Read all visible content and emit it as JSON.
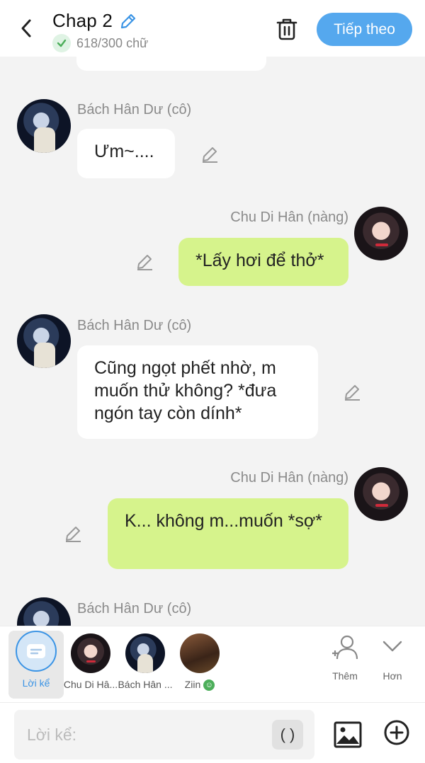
{
  "header": {
    "title": "Chap 2",
    "word_count": "618/300 chữ",
    "next_label": "Tiếp theo"
  },
  "colors": {
    "accent": "#55a8ee",
    "right_bubble": "#d6f38c",
    "left_bubble": "#ffffff",
    "check": "#4cae5a"
  },
  "messages": [
    {
      "side": "left",
      "name": "Bách Hân Dư (cô)",
      "text": "Ưm~...."
    },
    {
      "side": "right",
      "name": "Chu Di Hân (nàng)",
      "text": "*Lấy hơi để thở*"
    },
    {
      "side": "left",
      "name": "Bách Hân Dư (cô)",
      "text": "Cũng ngọt phết nhờ, m muốn thử không? *đưa ngón tay còn dính*"
    },
    {
      "side": "right",
      "name": "Chu Di Hân (nàng)",
      "text": "K... không m...muốn *sợ*"
    },
    {
      "side": "left",
      "name": "Bách Hân Dư (cô)",
      "text": ""
    }
  ],
  "characters": [
    {
      "label": "Lời kể",
      "icon": "narration-icon",
      "active": true
    },
    {
      "label": "Chu Di Hâ...",
      "icon": "avatar"
    },
    {
      "label": "Bách Hân ...",
      "icon": "avatar"
    },
    {
      "label": "Ziin",
      "icon": "avatar",
      "badge": "☺"
    }
  ],
  "actions": {
    "add_label": "Thêm",
    "more_label": "Hơn"
  },
  "input": {
    "placeholder": "Lời kể:",
    "paren_label": "( )"
  }
}
